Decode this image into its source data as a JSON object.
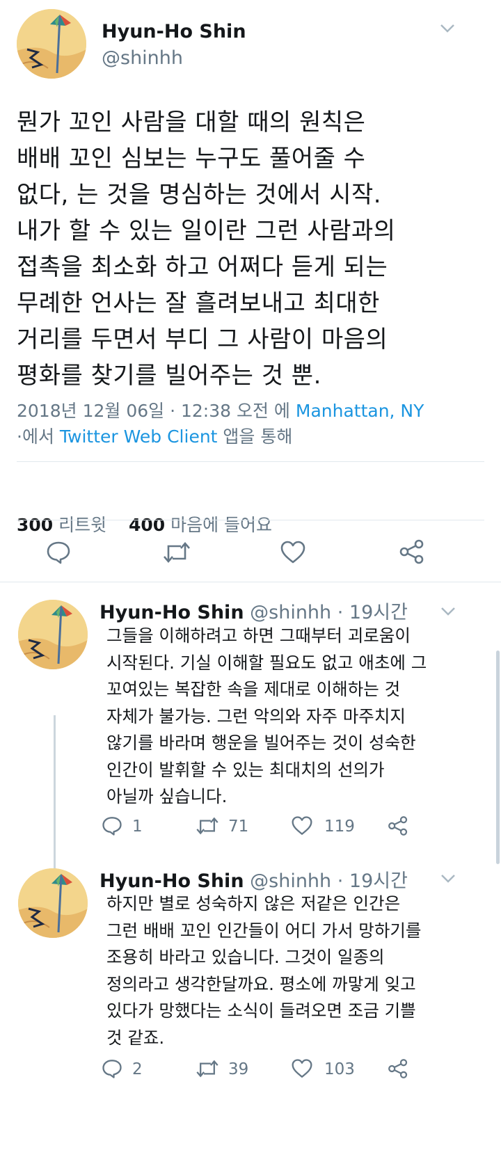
{
  "main_tweet": {
    "author_name": "Hyun-Ho Shin",
    "author_handle": "@shinhh",
    "text_lines": [
      "뭔가 꼬인 사람을 대할 때의 원칙은",
      "배배 꼬인 심보는 누구도 풀어줄 수",
      "없다, 는 것을 명심하는 것에서 시작.",
      "내가 할 수 있는 일이란 그런 사람과의",
      "접촉을 최소화 하고 어쩌다 듣게 되는",
      "무례한 언사는 잘 흘려보내고 최대한",
      "거리를 두면서 부디 그 사람이 마음의",
      "평화를 찾기를 빌어주는 것 뿐."
    ],
    "timestamp": "2018년 12월 06일 · 12:38 오전 에",
    "location": "Manhattan, NY",
    "via_prefix": "·에서",
    "client": "Twitter Web Client",
    "via_suffix": "앱을 통해",
    "retweet_count": "300",
    "retweet_label": "리트윗",
    "like_count": "400",
    "like_label": "마음에 들어요"
  },
  "replies": [
    {
      "author_name": "Hyun-Ho Shin",
      "author_handle": "@shinhh",
      "time": "· 19시간",
      "text_lines": [
        "그들을 이해하려고 하면 그때부터 괴로움이",
        "시작된다. 기실 이해할 필요도 없고 애초에 그",
        "꼬여있는 복잡한 속을 제대로 이해하는 것",
        "자체가 불가능. 그런 악의와 자주 마주치지",
        "않기를 바라며 행운을 빌어주는 것이 성숙한",
        "인간이 발휘할 수 있는 최대치의 선의가",
        "아닐까 싶습니다."
      ],
      "reply_count": "1",
      "retweet_count": "71",
      "like_count": "119"
    },
    {
      "author_name": "Hyun-Ho Shin",
      "author_handle": "@shinhh",
      "time": "· 19시간",
      "text_lines": [
        "하지만 별로 성숙하지 않은 저같은 인간은",
        "그런 배배 꼬인 인간들이 어디 가서 망하기를",
        "조용히 바라고 있습니다. 그것이 일종의",
        "정의라고 생각한달까요. 평소에 까맣게 잊고",
        "있다가 망했다는 소식이 들려오면 조금 기쁠",
        "것 같죠."
      ],
      "reply_count": "2",
      "retweet_count": "39",
      "like_count": "103"
    }
  ],
  "icons": {
    "reply": "reply-icon",
    "retweet": "retweet-icon",
    "like": "heart-icon",
    "share": "share-icon",
    "more": "chevron-down-icon"
  },
  "colors": {
    "link": "#1b95e0",
    "secondary_text": "#657786",
    "icon": "#657786",
    "divider": "#e1e8ed"
  }
}
